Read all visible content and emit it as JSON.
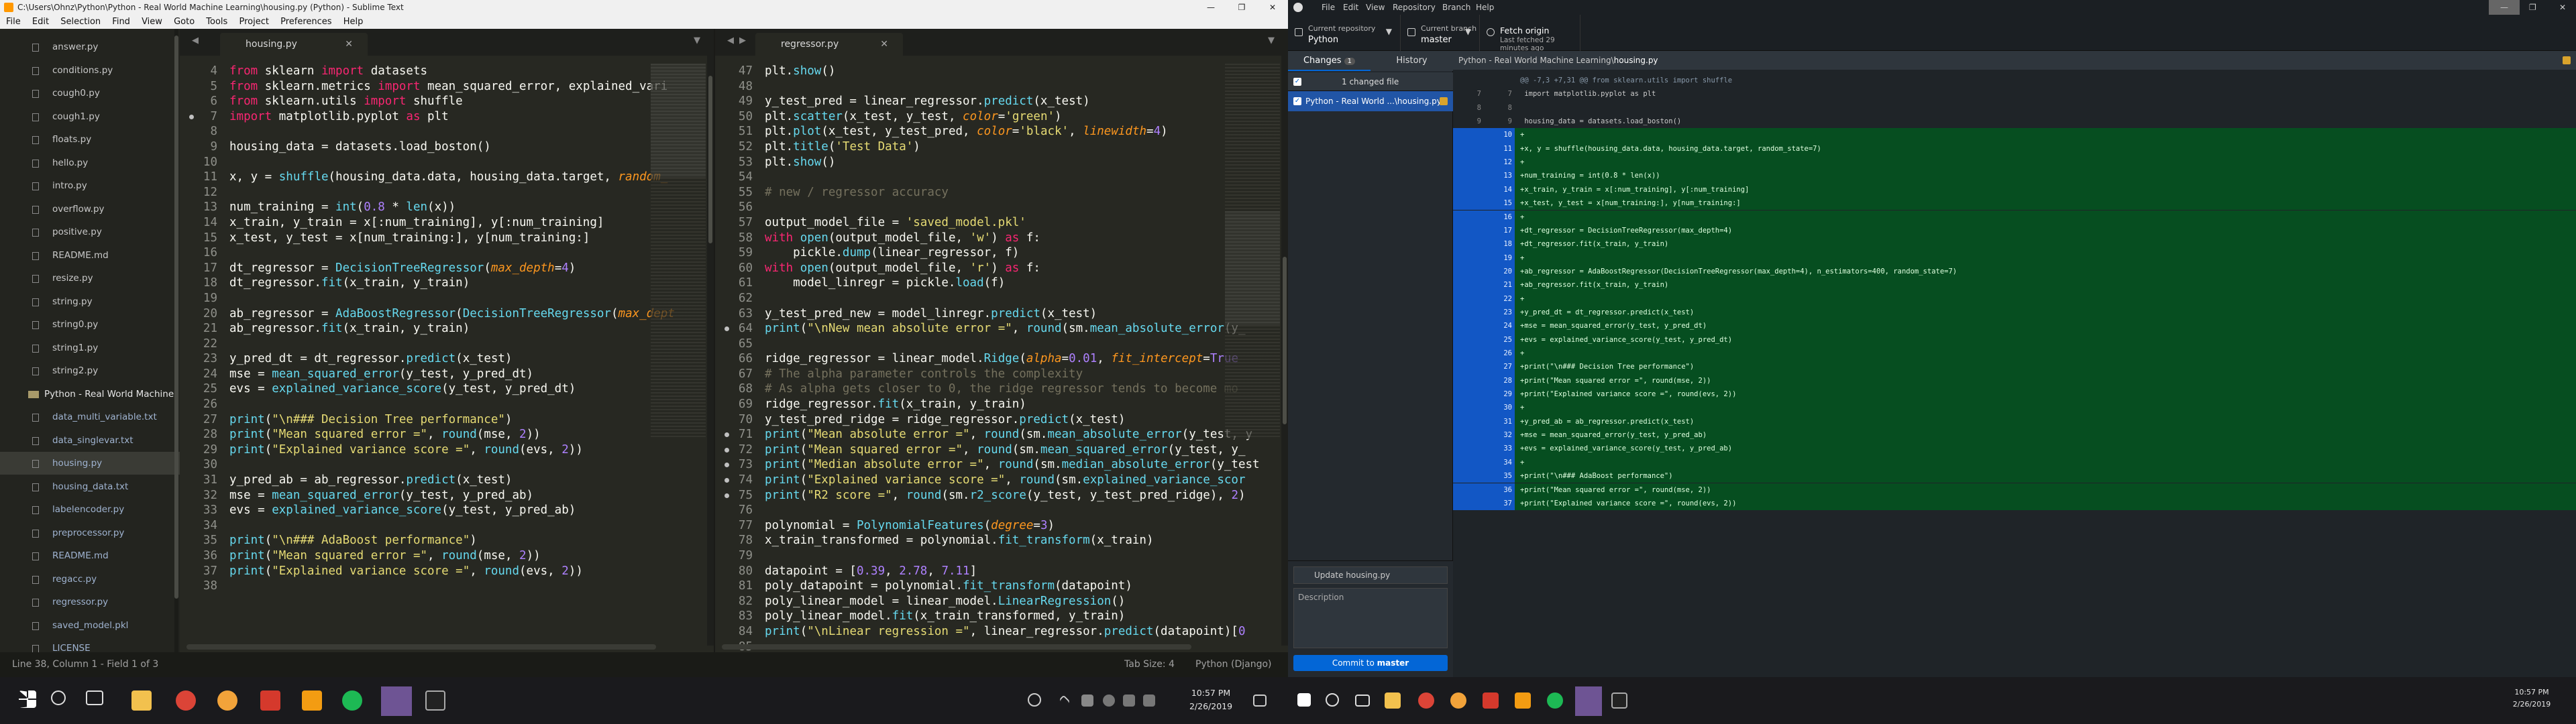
{
  "sublime": {
    "title": "C:\\Users\\Ohnz\\Python\\Python - Real World Machine Learning\\housing.py (Python) - Sublime Text",
    "menu": [
      "File",
      "Edit",
      "Selection",
      "Find",
      "View",
      "Goto",
      "Tools",
      "Project",
      "Preferences",
      "Help"
    ],
    "sidebar": [
      {
        "name": "answer.py",
        "kind": "file"
      },
      {
        "name": "conditions.py",
        "kind": "file"
      },
      {
        "name": "cough0.py",
        "kind": "file"
      },
      {
        "name": "cough1.py",
        "kind": "file"
      },
      {
        "name": "floats.py",
        "kind": "file"
      },
      {
        "name": "hello.py",
        "kind": "file"
      },
      {
        "name": "intro.py",
        "kind": "file"
      },
      {
        "name": "overflow.py",
        "kind": "file"
      },
      {
        "name": "positive.py",
        "kind": "file"
      },
      {
        "name": "README.md",
        "kind": "file"
      },
      {
        "name": "resize.py",
        "kind": "file"
      },
      {
        "name": "string.py",
        "kind": "file"
      },
      {
        "name": "string0.py",
        "kind": "file"
      },
      {
        "name": "string1.py",
        "kind": "file"
      },
      {
        "name": "string2.py",
        "kind": "file"
      },
      {
        "name": "Python - Real World Machine",
        "kind": "folder"
      },
      {
        "name": "data_multi_variable.txt",
        "kind": "sub"
      },
      {
        "name": "data_singlevar.txt",
        "kind": "sub"
      },
      {
        "name": "housing.py",
        "kind": "sub",
        "selected": true
      },
      {
        "name": "housing_data.txt",
        "kind": "sub"
      },
      {
        "name": "labelencoder.py",
        "kind": "sub"
      },
      {
        "name": "preprocessor.py",
        "kind": "sub"
      },
      {
        "name": "README.md",
        "kind": "sub"
      },
      {
        "name": "regacc.py",
        "kind": "sub"
      },
      {
        "name": "regressor.py",
        "kind": "sub"
      },
      {
        "name": "saved_model.pkl",
        "kind": "sub"
      },
      {
        "name": "LICENSE",
        "kind": "sub"
      }
    ],
    "pane1": {
      "tab": "housing.py",
      "lines": [
        {
          "n": "4",
          "h": "<span class='k'>from</span> sklearn <span class='k'>import</span> datasets"
        },
        {
          "n": "5",
          "h": "<span class='k'>from</span> sklearn.metrics <span class='k'>import</span> mean_squared_error, explained_vari"
        },
        {
          "n": "6",
          "h": "<span class='k'>from</span> sklearn.utils <span class='k'>import</span> shuffle"
        },
        {
          "n": "7",
          "h": "<span class='k'>import</span> matplotlib.pyplot <span class='k'>as</span> plt",
          "dot": true
        },
        {
          "n": "8",
          "h": ""
        },
        {
          "n": "9",
          "h": "housing_data = datasets.load_boston()"
        },
        {
          "n": "10",
          "h": ""
        },
        {
          "n": "11",
          "h": "x, y = <span class='f'>shuffle</span>(housing_data.data, housing_data.target, <span class='a'>random_</span>"
        },
        {
          "n": "12",
          "h": ""
        },
        {
          "n": "13",
          "h": "num_training = <span class='f'>int</span>(<span class='n'>0.8</span> * <span class='f'>len</span>(x))"
        },
        {
          "n": "14",
          "h": "x_train, y_train = x[:num_training], y[:num_training]"
        },
        {
          "n": "15",
          "h": "x_test, y_test = x[num_training:], y[num_training:]"
        },
        {
          "n": "16",
          "h": ""
        },
        {
          "n": "17",
          "h": "dt_regressor = <span class='f'>DecisionTreeRegressor</span>(<span class='a'>max_depth</span>=<span class='n'>4</span>)"
        },
        {
          "n": "18",
          "h": "dt_regressor.<span class='f'>fit</span>(x_train, y_train)"
        },
        {
          "n": "19",
          "h": ""
        },
        {
          "n": "20",
          "h": "ab_regressor = <span class='f'>AdaBoostRegressor</span>(<span class='f'>DecisionTreeRegressor</span>(<span class='a'>max_dept</span>"
        },
        {
          "n": "21",
          "h": "ab_regressor.<span class='f'>fit</span>(x_train, y_train)"
        },
        {
          "n": "22",
          "h": ""
        },
        {
          "n": "23",
          "h": "y_pred_dt = dt_regressor.<span class='f'>predict</span>(x_test)"
        },
        {
          "n": "24",
          "h": "mse = <span class='f'>mean_squared_error</span>(y_test, y_pred_dt)"
        },
        {
          "n": "25",
          "h": "evs = <span class='f'>explained_variance_score</span>(y_test, y_pred_dt)"
        },
        {
          "n": "26",
          "h": ""
        },
        {
          "n": "27",
          "h": "<span class='f'>print</span>(<span class='s'>\"\\n### Decision Tree performance\"</span>)"
        },
        {
          "n": "28",
          "h": "<span class='f'>print</span>(<span class='s'>\"Mean squared error =\"</span>, <span class='f'>round</span>(mse, <span class='n'>2</span>))"
        },
        {
          "n": "29",
          "h": "<span class='f'>print</span>(<span class='s'>\"Explained variance score =\"</span>, <span class='f'>round</span>(evs, <span class='n'>2</span>))"
        },
        {
          "n": "30",
          "h": ""
        },
        {
          "n": "31",
          "h": "y_pred_ab = ab_regressor.<span class='f'>predict</span>(x_test)"
        },
        {
          "n": "32",
          "h": "mse = <span class='f'>mean_squared_error</span>(y_test, y_pred_ab)"
        },
        {
          "n": "33",
          "h": "evs = <span class='f'>explained_variance_score</span>(y_test, y_pred_ab)"
        },
        {
          "n": "34",
          "h": ""
        },
        {
          "n": "35",
          "h": "<span class='f'>print</span>(<span class='s'>\"\\n### AdaBoost performance\"</span>)"
        },
        {
          "n": "36",
          "h": "<span class='f'>print</span>(<span class='s'>\"Mean squared error =\"</span>, <span class='f'>round</span>(mse, <span class='n'>2</span>))"
        },
        {
          "n": "37",
          "h": "<span class='f'>print</span>(<span class='s'>\"Explained variance score =\"</span>, <span class='f'>round</span>(evs, <span class='n'>2</span>))"
        },
        {
          "n": "38",
          "h": ""
        }
      ]
    },
    "pane2": {
      "tab": "regressor.py",
      "lines": [
        {
          "n": "47",
          "h": "plt.<span class='f'>show</span>()"
        },
        {
          "n": "48",
          "h": ""
        },
        {
          "n": "49",
          "h": "y_test_pred = linear_regressor.<span class='f'>predict</span>(x_test)"
        },
        {
          "n": "50",
          "h": "plt.<span class='f'>scatter</span>(x_test, y_test, <span class='a'>color</span>=<span class='s'>'green'</span>)"
        },
        {
          "n": "51",
          "h": "plt.<span class='f'>plot</span>(x_test, y_test_pred, <span class='a'>color</span>=<span class='s'>'black'</span>, <span class='a'>linewidth</span>=<span class='n'>4</span>)"
        },
        {
          "n": "52",
          "h": "plt.<span class='f'>title</span>(<span class='s'>'Test Data'</span>)"
        },
        {
          "n": "53",
          "h": "plt.<span class='f'>show</span>()"
        },
        {
          "n": "54",
          "h": ""
        },
        {
          "n": "55",
          "h": "<span class='c'># new / regressor accuracy</span>"
        },
        {
          "n": "56",
          "h": ""
        },
        {
          "n": "57",
          "h": "output_model_file = <span class='s'>'saved_model.pkl'</span>"
        },
        {
          "n": "58",
          "h": "<span class='k'>with</span> <span class='f'>open</span>(output_model_file, <span class='s'>'w'</span>) <span class='k'>as</span> f:"
        },
        {
          "n": "59",
          "h": "    pickle.<span class='f'>dump</span>(linear_regressor, f)"
        },
        {
          "n": "60",
          "h": "<span class='k'>with</span> <span class='f'>open</span>(output_model_file, <span class='s'>'r'</span>) <span class='k'>as</span> f:"
        },
        {
          "n": "61",
          "h": "    model_linregr = pickle.<span class='f'>load</span>(f)"
        },
        {
          "n": "62",
          "h": ""
        },
        {
          "n": "63",
          "h": "y_test_pred_new = model_linregr.<span class='f'>predict</span>(x_test)"
        },
        {
          "n": "64",
          "h": "<span class='f'>print</span>(<span class='s'>\"\\nNew mean absolute error =\"</span>, <span class='f'>round</span>(sm.<span class='f'>mean_absolute_error</span>(y_",
          "dot": true
        },
        {
          "n": "65",
          "h": ""
        },
        {
          "n": "66",
          "h": "ridge_regressor = linear_model.<span class='f'>Ridge</span>(<span class='a'>alpha</span>=<span class='n'>0.01</span>, <span class='a'>fit_intercept</span>=<span class='n'>True</span>"
        },
        {
          "n": "67",
          "h": "<span class='c'># The alpha parameter controls the complexity</span>"
        },
        {
          "n": "68",
          "h": "<span class='c'># As alpha gets closer to 0, the ridge regressor tends to become mo</span>"
        },
        {
          "n": "69",
          "h": "ridge_regressor.<span class='f'>fit</span>(x_train, y_train)"
        },
        {
          "n": "70",
          "h": "y_test_pred_ridge = ridge_regressor.<span class='f'>predict</span>(x_test)"
        },
        {
          "n": "71",
          "h": "<span class='f'>print</span>(<span class='s'>\"Mean absolute error =\"</span>, <span class='f'>round</span>(sm.<span class='f'>mean_absolute_error</span>(y_test, y",
          "dot": true
        },
        {
          "n": "72",
          "h": "<span class='f'>print</span>(<span class='s'>\"Mean squared error =\"</span>, <span class='f'>round</span>(sm.<span class='f'>mean_squared_error</span>(y_test, y_",
          "dot": true
        },
        {
          "n": "73",
          "h": "<span class='f'>print</span>(<span class='s'>\"Median absolute error =\"</span>, <span class='f'>round</span>(sm.<span class='f'>median_absolute_error</span>(y_test",
          "dot": true
        },
        {
          "n": "74",
          "h": "<span class='f'>print</span>(<span class='s'>\"Explained variance score =\"</span>, <span class='f'>round</span>(sm.<span class='f'>explained_variance_scor</span>",
          "dot": true
        },
        {
          "n": "75",
          "h": "<span class='f'>print</span>(<span class='s'>\"R2 score =\"</span>, <span class='f'>round</span>(sm.<span class='f'>r2_score</span>(y_test, y_test_pred_ridge), <span class='n'>2</span>)",
          "dot": true
        },
        {
          "n": "76",
          "h": ""
        },
        {
          "n": "77",
          "h": "polynomial = <span class='f'>PolynomialFeatures</span>(<span class='a'>degree</span>=<span class='n'>3</span>)"
        },
        {
          "n": "78",
          "h": "x_train_transformed = polynomial.<span class='f'>fit_transform</span>(x_train)"
        },
        {
          "n": "79",
          "h": ""
        },
        {
          "n": "80",
          "h": "datapoint = [<span class='n'>0.39</span>, <span class='n'>2.78</span>, <span class='n'>7.11</span>]"
        },
        {
          "n": "81",
          "h": "poly_datapoint = polynomial.<span class='f'>fit_transform</span>(datapoint)"
        },
        {
          "n": "82",
          "h": "poly_linear_model = linear_model.<span class='f'>LinearRegression</span>()"
        },
        {
          "n": "83",
          "h": "poly_linear_model.<span class='f'>fit</span>(x_train_transformed, y_train)"
        },
        {
          "n": "84",
          "h": "<span class='f'>print</span>(<span class='s'>\"\\nLinear regression =\"</span>, linear_regressor.<span class='f'>predict</span>(datapoint)[<span class='n'>0</span>"
        },
        {
          "n": "85",
          "h": ""
        }
      ]
    },
    "status": {
      "left": "Line 38, Column 1 - Field 1 of 3",
      "tab_size": "Tab Size: 4",
      "syntax": "Python (Django)"
    }
  },
  "taskbar1": {
    "time": "10:57 PM",
    "date": "2/26/2019"
  },
  "taskbar2": {
    "time": "10:57 PM",
    "date": "2/26/2019"
  },
  "github": {
    "menu": [
      "File",
      "Edit",
      "View",
      "Repository",
      "Branch",
      "Help"
    ],
    "repo_label": "Current repository",
    "repo": "Python",
    "branch_label": "Current branch",
    "branch": "master",
    "fetch_label": "Fetch origin",
    "fetch_sub": "Last fetched 29 minutes ago",
    "tab_changes": "Changes",
    "tab_changes_count": "1",
    "tab_history": "History",
    "changed_count": "1 changed file",
    "file": "Python - Real World ...\\housing.py",
    "summary_placeholder": "Update housing.py",
    "desc_placeholder": "Description",
    "commit_prefix": "Commit to ",
    "commit_branch": "master",
    "diff_path_prefix": "Python - Real World Machine Learning\\",
    "diff_path_file": "housing.py",
    "diff": [
      {
        "o": "",
        "n": "",
        "t": "@@ -7,3 +7,31 @@ from sklearn.utils import shuffle",
        "type": "hunk"
      },
      {
        "o": "7",
        "n": "7",
        "t": " import matplotlib.pyplot as plt",
        "type": "ctx"
      },
      {
        "o": "8",
        "n": "8",
        "t": "",
        "type": "ctx"
      },
      {
        "o": "9",
        "n": "9",
        "t": " housing_data = datasets.load_boston()",
        "type": "ctx"
      },
      {
        "o": "",
        "n": "10",
        "t": "+",
        "type": "add"
      },
      {
        "o": "",
        "n": "11",
        "t": "+x, y = shuffle(housing_data.data, housing_data.target, random_state=7)",
        "type": "add"
      },
      {
        "o": "",
        "n": "12",
        "t": "+",
        "type": "add"
      },
      {
        "o": "",
        "n": "13",
        "t": "+num_training = int(0.8 * len(x))",
        "type": "add"
      },
      {
        "o": "",
        "n": "14",
        "t": "+x_train, y_train = x[:num_training], y[:num_training]",
        "type": "add"
      },
      {
        "o": "",
        "n": "15",
        "t": "+x_test, y_test = x[num_training:], y[num_training:]",
        "type": "add"
      },
      {
        "o": "",
        "n": "16",
        "t": "+",
        "type": "add"
      },
      {
        "o": "",
        "n": "17",
        "t": "+dt_regressor = DecisionTreeRegressor(max_depth=4)",
        "type": "add"
      },
      {
        "o": "",
        "n": "18",
        "t": "+dt_regressor.fit(x_train, y_train)",
        "type": "add"
      },
      {
        "o": "",
        "n": "19",
        "t": "+",
        "type": "add"
      },
      {
        "o": "",
        "n": "20",
        "t": "+ab_regressor = AdaBoostRegressor(DecisionTreeRegressor(max_depth=4), n_estimators=400, random_state=7)",
        "type": "add"
      },
      {
        "o": "",
        "n": "21",
        "t": "+ab_regressor.fit(x_train, y_train)",
        "type": "add"
      },
      {
        "o": "",
        "n": "22",
        "t": "+",
        "type": "add"
      },
      {
        "o": "",
        "n": "23",
        "t": "+y_pred_dt = dt_regressor.predict(x_test)",
        "type": "add"
      },
      {
        "o": "",
        "n": "24",
        "t": "+mse = mean_squared_error(y_test, y_pred_dt)",
        "type": "add"
      },
      {
        "o": "",
        "n": "25",
        "t": "+evs = explained_variance_score(y_test, y_pred_dt)",
        "type": "add"
      },
      {
        "o": "",
        "n": "26",
        "t": "+",
        "type": "add"
      },
      {
        "o": "",
        "n": "27",
        "t": "+print(\"\\n### Decision Tree performance\")",
        "type": "add"
      },
      {
        "o": "",
        "n": "28",
        "t": "+print(\"Mean squared error =\", round(mse, 2))",
        "type": "add"
      },
      {
        "o": "",
        "n": "29",
        "t": "+print(\"Explained variance score =\", round(evs, 2))",
        "type": "add"
      },
      {
        "o": "",
        "n": "30",
        "t": "+",
        "type": "add"
      },
      {
        "o": "",
        "n": "31",
        "t": "+y_pred_ab = ab_regressor.predict(x_test)",
        "type": "add"
      },
      {
        "o": "",
        "n": "32",
        "t": "+mse = mean_squared_error(y_test, y_pred_ab)",
        "type": "add"
      },
      {
        "o": "",
        "n": "33",
        "t": "+evs = explained_variance_score(y_test, y_pred_ab)",
        "type": "add"
      },
      {
        "o": "",
        "n": "34",
        "t": "+",
        "type": "add"
      },
      {
        "o": "",
        "n": "35",
        "t": "+print(\"\\n### AdaBoost performance\")",
        "type": "add"
      },
      {
        "o": "",
        "n": "36",
        "t": "+print(\"Mean squared error =\", round(mse, 2))",
        "type": "add"
      },
      {
        "o": "",
        "n": "37",
        "t": "+print(\"Explained variance score =\", round(evs, 2))",
        "type": "add"
      }
    ]
  },
  "colors": {
    "sublime_bg": "#272822",
    "keyword": "#f92672",
    "function": "#66d9ef",
    "string": "#e6db74",
    "number": "#ae81ff",
    "comment": "#75715e",
    "diff_add": "#064e20",
    "accent": "#0366d6"
  }
}
